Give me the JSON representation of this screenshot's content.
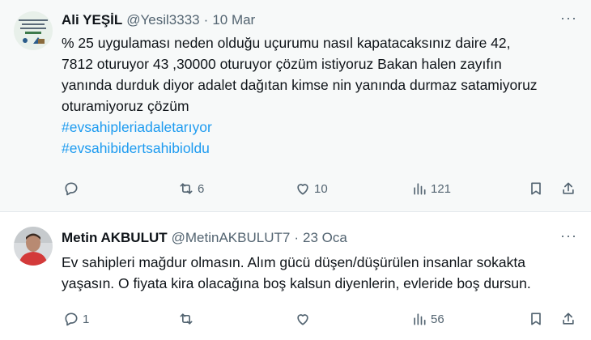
{
  "tweets": [
    {
      "name": "Ali YEŞİL",
      "handle": "@Yesil3333",
      "separator": "·",
      "date": "10 Mar",
      "more": "···",
      "text_lines": [
        "% 25 uygulaması neden olduğu uçurumu nasıl kapatacaksınız daire 42,",
        "7812 oturuyor 43 ,30000 oturuyor çözüm istiyoruz Bakan halen zayıfın",
        "yanında durduk diyor adalet dağıtan kimse nin yanında durmaz satamiyoruz",
        "oturamiyoruz çözüm"
      ],
      "hashtags": [
        "#evsahipleriadaletarıyor",
        "#evsahibidertsahibioldu"
      ],
      "replies": "",
      "retweets": "6",
      "likes": "10",
      "views": "121"
    },
    {
      "name": "Metin AKBULUT",
      "handle": "@MetinAKBULUT7",
      "separator": "·",
      "date": "23 Oca",
      "more": "···",
      "text_lines": [
        "Ev sahipleri mağdur olmasın. Alım gücü düşen/düşürülen insanlar sokakta",
        "yaşasın. O fiyata kira olacağına boş kalsun diyenlerin, evleride boş dursun."
      ],
      "hashtags": [],
      "replies": "1",
      "retweets": "",
      "likes": "",
      "views": "56"
    }
  ],
  "icons": {
    "reply": "reply-icon",
    "retweet": "retweet-icon",
    "like": "like-icon",
    "views": "views-icon",
    "bookmark": "bookmark-icon",
    "share": "share-icon"
  },
  "colors": {
    "link": "#1d9bf0",
    "secondary_text": "#536471",
    "highlight_bg": "#f7f9f9"
  }
}
